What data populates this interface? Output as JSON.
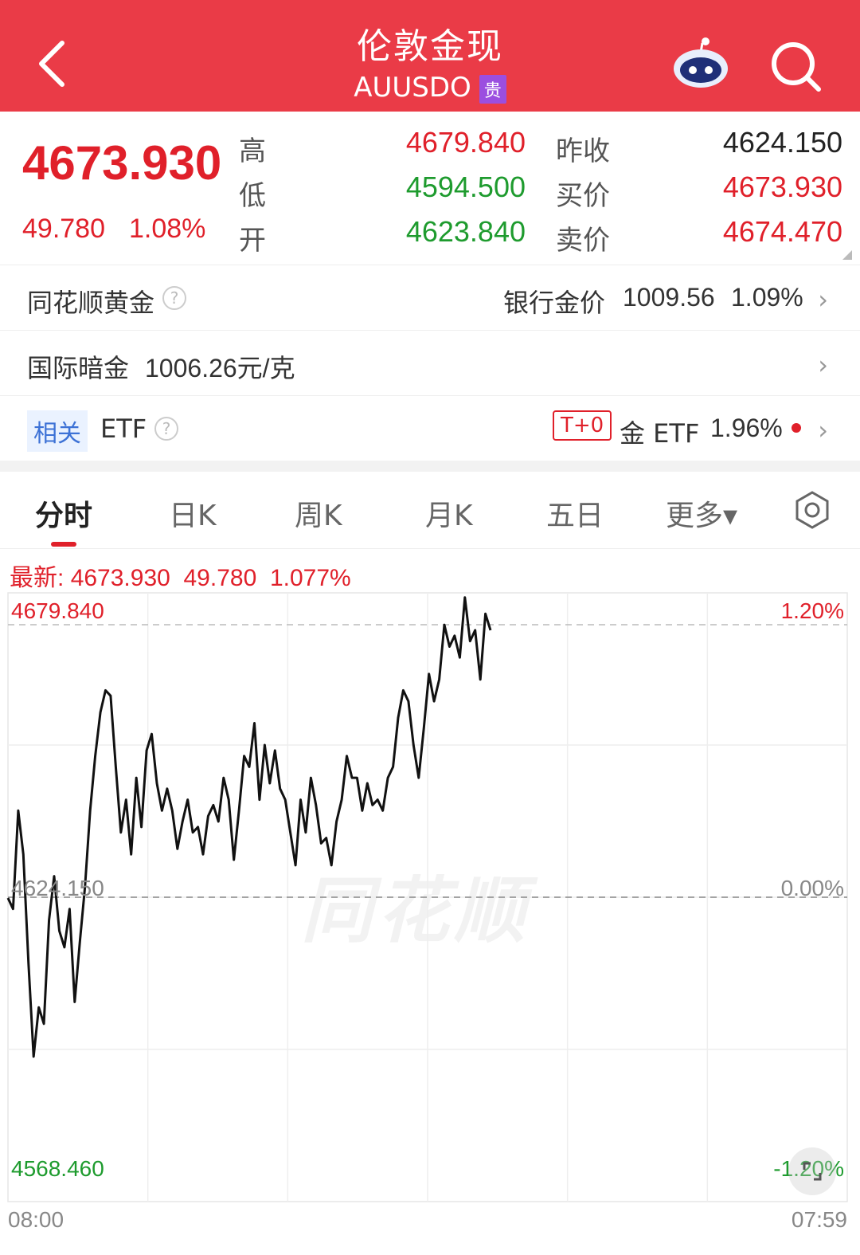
{
  "header": {
    "title": "伦敦金现",
    "code": "AUUSDO",
    "type_tag": "贵",
    "back_icon": "chevron-left-icon",
    "assistant_icon": "robot-icon",
    "search_icon": "search-icon",
    "background": "#ea3b47"
  },
  "quote": {
    "price": "4673.930",
    "change": "49.780",
    "change_pct": "1.08%",
    "high_label": "高",
    "high": "4679.840",
    "low_label": "低",
    "low": "4594.500",
    "open_label": "开",
    "open": "4623.840",
    "prev_close_label": "昨收",
    "prev_close": "4624.150",
    "bid_label": "买价",
    "bid": "4673.930",
    "ask_label": "卖价",
    "ask": "4674.470"
  },
  "rows": {
    "ths_gold": {
      "label": "同花顺黄金",
      "bank_label": "银行金价",
      "bank_price": "1009.56",
      "bank_pct": "1.09%"
    },
    "dark_gold": {
      "label": "国际暗金",
      "value": "1006.26元/克"
    },
    "etf": {
      "related_tag": "相关",
      "label": "ETF",
      "t0_tag": "T+0",
      "gold_etf_label": "金 ETF",
      "gold_etf_pct": "1.96%"
    }
  },
  "tabs": [
    "分时",
    "日K",
    "周K",
    "月K",
    "五日",
    "更多▾"
  ],
  "tab_active": "分时",
  "latest": {
    "label": "最新:",
    "price": "4673.930",
    "change": "49.780",
    "pct": "1.077%"
  },
  "watermark": "同花顺",
  "chart_data": {
    "type": "line",
    "y_top_label": "4679.840",
    "y_mid_label": "4624.150",
    "y_bottom_label": "4568.460",
    "pct_top_label": "1.20%",
    "pct_mid_label": "0.00%",
    "pct_bottom_label": "-1.20%",
    "x_start_label": "08:00",
    "x_end_label": "07:59",
    "ylim": [
      4568.46,
      4679.84
    ],
    "reference_line": 4624.15,
    "series": [
      {
        "values": [
          4624,
          4622,
          4640,
          4632,
          4612,
          4595,
          4604,
          4601,
          4620,
          4628,
          4618,
          4615,
          4622,
          4605,
          4616,
          4626,
          4640,
          4650,
          4658,
          4662,
          4661,
          4648,
          4636,
          4642,
          4632,
          4646,
          4637,
          4651,
          4654,
          4645,
          4640,
          4644,
          4640,
          4633,
          4638,
          4642,
          4636,
          4637,
          4632,
          4639,
          4641,
          4638,
          4646,
          4642,
          4631,
          4640,
          4650,
          4648,
          4656,
          4642,
          4652,
          4645,
          4651,
          4644,
          4642,
          4636,
          4630,
          4642,
          4636,
          4646,
          4641,
          4634,
          4635,
          4630,
          4638,
          4642,
          4650,
          4646,
          4646,
          4640,
          4645,
          4641,
          4642,
          4640,
          4646,
          4648,
          4657,
          4662,
          4660,
          4652,
          4646,
          4655,
          4665,
          4660,
          4664,
          4674,
          4670,
          4672,
          4668,
          4679,
          4671,
          4673,
          4664,
          4676,
          4673
        ]
      }
    ]
  }
}
